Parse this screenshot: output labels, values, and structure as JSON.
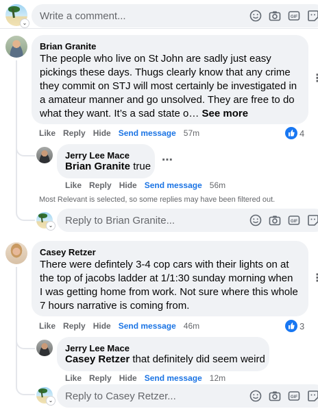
{
  "composer": {
    "placeholder": "Write a comment..."
  },
  "comments": [
    {
      "author": "Brian Granite",
      "lines": [
        "The people who live on St John are sadly just easy",
        "pickings these days. Thugs clearly know that any crime",
        "they commit on STJ will most certainly be investigated in",
        "a amateur manner and go unsolved. They are free to do",
        "what they want. It’s a sad state o…"
      ],
      "see_more": "See more",
      "actions": {
        "like": "Like",
        "reply": "Reply",
        "hide": "Hide",
        "send": "Send message",
        "time": "57m"
      },
      "reaction_count": "4",
      "reply": {
        "author": "Jerry Lee Mace",
        "mention": "Brian Granite",
        "text": " true",
        "actions": {
          "like": "Like",
          "reply": "Reply",
          "hide": "Hide",
          "send": "Send message",
          "time": "56m"
        }
      },
      "filter_note": "Most Relevant is selected, so some replies may have been filtered out.",
      "reply_box_placeholder": "Reply to Brian Granite..."
    },
    {
      "author": "Casey Retzer",
      "lines": [
        "There were defintely 3-4 cop cars with their lights on at",
        "the top of jacobs ladder at 1/1:30 sunday morning when",
        "I was getting home from work. Not sure where this whole",
        "7 hours narrative is coming from."
      ],
      "actions": {
        "like": "Like",
        "reply": "Reply",
        "hide": "Hide",
        "send": "Send message",
        "time": "46m"
      },
      "reaction_count": "3",
      "reply": {
        "author": "Jerry Lee Mace",
        "mention": "Casey Retzer",
        "text": " that definitely did seem weird",
        "actions": {
          "like": "Like",
          "reply": "Reply",
          "hide": "Hide",
          "send": "Send message",
          "time": "12m"
        }
      },
      "reply_box_placeholder": "Reply to Casey Retzer..."
    }
  ],
  "icons": [
    "smiley-icon",
    "camera-icon",
    "gif-icon",
    "sticker-icon",
    "like-thumb-icon",
    "more-dots-icon",
    "chevron-down-icon"
  ],
  "colors": {
    "accent": "#1b74e4",
    "bubble": "#f0f2f5",
    "muted": "#65676b",
    "like": "#1877f2"
  }
}
